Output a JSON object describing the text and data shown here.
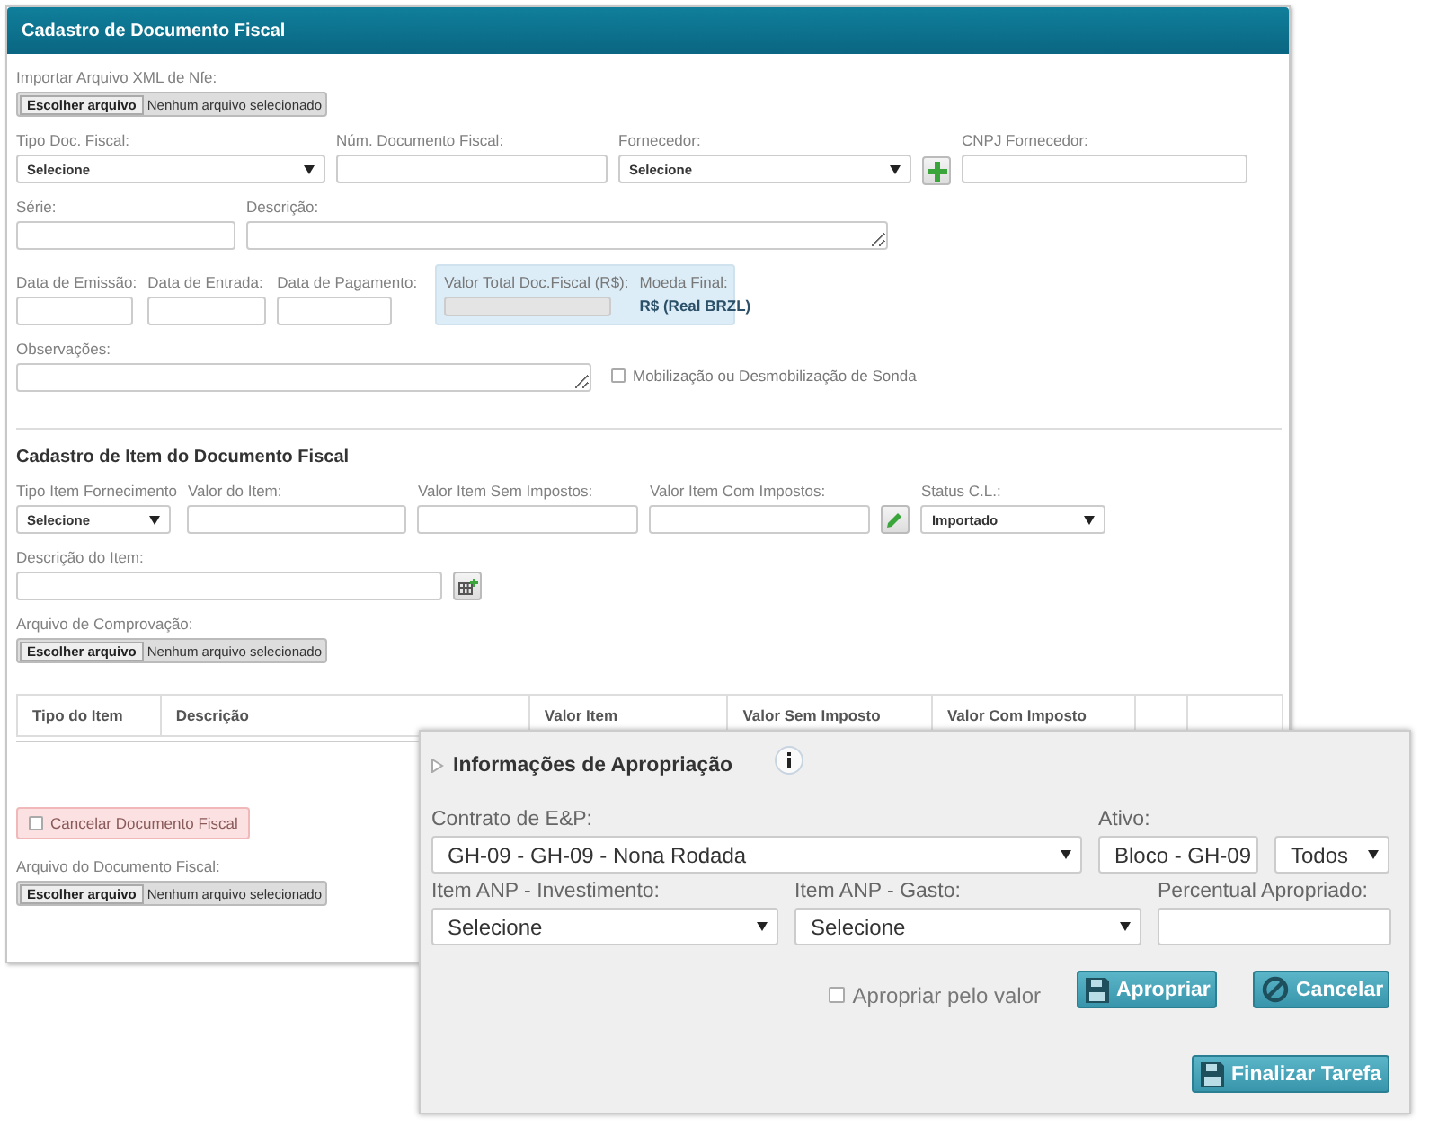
{
  "panel": {
    "title": "Cadastro de Documento Fiscal"
  },
  "document": {
    "rows": [
      {
        "fields": [
          {
            "kind": "file",
            "label": "Importar Arquivo XML de Nfe:",
            "button": "Escolher arquivo",
            "status": "Nenhum arquivo selecionado"
          }
        ]
      },
      {
        "fields": [
          {
            "kind": "select",
            "label": "Tipo Doc. Fiscal:",
            "value": "Selecione"
          },
          {
            "kind": "input",
            "label": "Núm. Documento Fiscal:"
          },
          {
            "kind": "select",
            "label": "Fornecedor:",
            "value": "Selecione"
          },
          {
            "kind": "add_button"
          },
          {
            "kind": "input",
            "label": "CNPJ Fornecedor:"
          }
        ]
      },
      {
        "fields": [
          {
            "kind": "input",
            "label": "Série:"
          },
          {
            "kind": "textarea",
            "label": "Descrição:"
          }
        ]
      },
      {
        "fields": [
          {
            "kind": "input",
            "label": "Data de Emissão:"
          },
          {
            "kind": "input",
            "label": "Data de Entrada:"
          },
          {
            "kind": "input",
            "label": "Data de Pagamento:"
          },
          {
            "kind": "total_box",
            "label": "Valor Total Doc.Fiscal (R$):",
            "currency_label": "Moeda Final:",
            "currency": "R$ (Real BRZL)"
          }
        ]
      },
      {
        "fields": [
          {
            "kind": "textarea",
            "label": "Observações:"
          },
          {
            "kind": "checkbox",
            "label": "Mobilização ou Desmobilização de Sonda",
            "checked": false
          }
        ]
      }
    ]
  },
  "items": {
    "heading": "Cadastro de Item do Documento Fiscal",
    "rows": [
      {
        "fields": [
          {
            "kind": "select",
            "label": "Tipo Item Fornecimento",
            "value": "Selecione"
          },
          {
            "kind": "input",
            "label": "Valor do Item:"
          },
          {
            "kind": "input",
            "label": "Valor Item Sem Impostos:"
          },
          {
            "kind": "input",
            "label": "Valor Item Com Impostos:"
          },
          {
            "kind": "edit_button"
          },
          {
            "kind": "select",
            "label": "Status C.L.:",
            "value": "Importado"
          }
        ]
      },
      {
        "fields": [
          {
            "kind": "input",
            "label": "Descrição do Item:"
          },
          {
            "kind": "table_button"
          }
        ]
      },
      {
        "fields": [
          {
            "kind": "file",
            "label": "Arquivo de Comprovação:",
            "button": "Escolher arquivo",
            "status": "Nenhum arquivo selecionado"
          }
        ]
      }
    ],
    "table": {
      "columns": [
        "Tipo do Item",
        "Descrição",
        "Valor Item",
        "Valor Sem Imposto",
        "Valor Com Imposto"
      ]
    }
  },
  "cancellation": {
    "rows": [
      {
        "fields": [
          {
            "kind": "cancel_checkbox",
            "label": "Cancelar Documento Fiscal",
            "checked": false
          }
        ]
      },
      {
        "fields": [
          {
            "kind": "file",
            "label": "Arquivo do Documento Fiscal:",
            "button": "Escolher arquivo",
            "status": "Nenhum arquivo selecionado"
          }
        ]
      }
    ]
  },
  "appropriation": {
    "title": "Informações de Apropriação",
    "expanded": false,
    "rows": [
      {
        "fields": [
          {
            "kind": "select",
            "label": "Contrato de E&P:",
            "value": "GH-09 - GH-09 - Nona Rodada"
          },
          {
            "kind": "select",
            "label": "Ativo:",
            "value": "Bloco - GH-09"
          },
          {
            "kind": "select",
            "value": "Todos"
          }
        ]
      },
      {
        "fields": [
          {
            "kind": "select",
            "label": "Item ANP - Investimento:",
            "value": "Selecione"
          },
          {
            "kind": "select",
            "label": "Item ANP - Gasto:",
            "value": "Selecione"
          },
          {
            "kind": "input",
            "label": "Percentual Apropriado:"
          }
        ]
      }
    ],
    "by_value": {
      "label": "Apropriar pelo valor",
      "checked": false
    },
    "buttons": [
      {
        "kind": "save",
        "label": "Apropriar"
      },
      {
        "kind": "cancel",
        "label": "Cancelar"
      }
    ],
    "finish_button": {
      "kind": "save",
      "label": "Finalizar Tarefa"
    }
  }
}
